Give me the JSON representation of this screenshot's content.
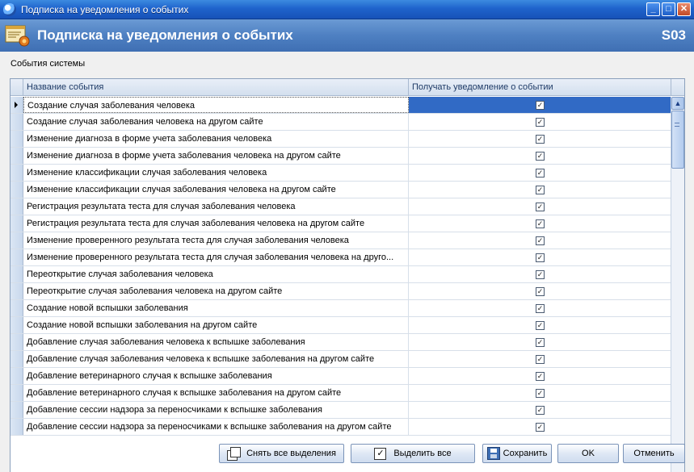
{
  "window": {
    "title": "Подписка на уведомления о событих",
    "minimize": "_",
    "maximize": "□",
    "close": "✕"
  },
  "banner": {
    "title": "Подписка на уведомления о событих",
    "code": "S03"
  },
  "section_label": "События системы",
  "grid": {
    "columns": [
      "Название события",
      "Получать уведомление о событии"
    ],
    "rows": [
      {
        "name": "Создание случая заболевания человека",
        "checked": "✓"
      },
      {
        "name": "Создание случая заболевания человека на другом сайте",
        "checked": "✓"
      },
      {
        "name": "Изменение диагноза в форме учета заболевания человека",
        "checked": "✓"
      },
      {
        "name": "Изменение диагноза в форме учета заболевания человека на другом сайте",
        "checked": "✓"
      },
      {
        "name": "Изменение классификации случая заболевания человека",
        "checked": "✓"
      },
      {
        "name": "Изменение классификации случая заболевания человека на другом сайте",
        "checked": "✓"
      },
      {
        "name": "Регистрация результата теста для случая заболевания человека",
        "checked": "✓"
      },
      {
        "name": "Регистрация результата теста для случая заболевания человека на другом сайте",
        "checked": "✓"
      },
      {
        "name": "Изменение проверенного результата теста для случая заболевания человека",
        "checked": "✓"
      },
      {
        "name": "Изменение проверенного результата теста для случая заболевания человека на друго...",
        "checked": "✓"
      },
      {
        "name": "Переоткрытие случая заболевания человека",
        "checked": "✓"
      },
      {
        "name": "Переоткрытие случая заболевания человека на другом сайте",
        "checked": "✓"
      },
      {
        "name": "Создание новой вспышки заболевания",
        "checked": "✓"
      },
      {
        "name": "Создание новой вспышки заболевания на другом сайте",
        "checked": "✓"
      },
      {
        "name": "Добавление случая заболевания человека к вспышке заболевания",
        "checked": "✓"
      },
      {
        "name": "Добавление случая заболевания человека к вспышке заболевания на другом сайте",
        "checked": "✓"
      },
      {
        "name": "Добавление ветеринарного случая к вспышке заболевания",
        "checked": "✓"
      },
      {
        "name": "Добавление ветеринарного случая к вспышке заболевания на другом сайте",
        "checked": "✓"
      },
      {
        "name": "Добавление сессии надзора за переносчиками к вспышке заболевания",
        "checked": "✓"
      },
      {
        "name": "Добавление сессии надзора за переносчиками к вспышке заболевания на другом сайте",
        "checked": "✓"
      }
    ]
  },
  "buttons": {
    "deselect_all": "Снять все выделения",
    "select_all": "Выделить все",
    "save": "Сохранить",
    "ok": "OK",
    "cancel": "Отменить"
  },
  "scrollbar": {
    "up": "▲",
    "down": "▼"
  },
  "colors": {
    "selection": "#316ac5",
    "banner": "#4e80c2",
    "titlebar": "#1f63cc"
  }
}
